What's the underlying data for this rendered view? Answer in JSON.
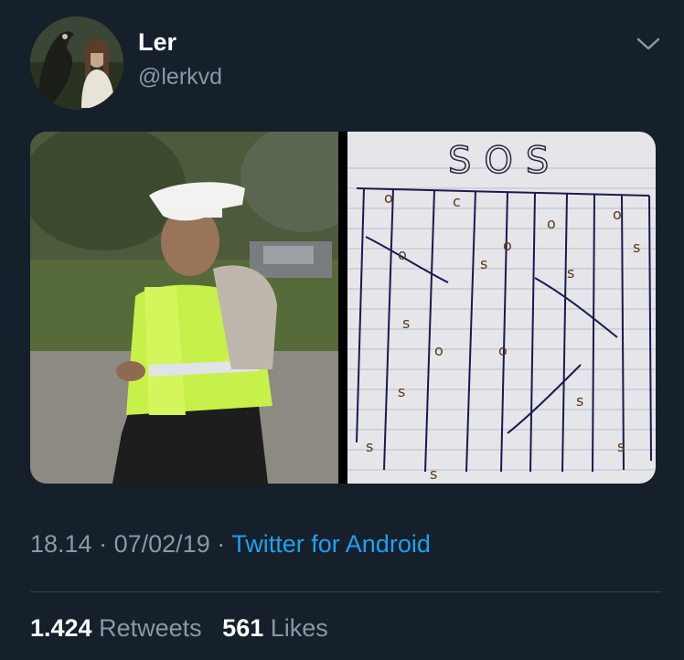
{
  "user": {
    "name": "Ler",
    "handle": "@lerkvd",
    "avatar_icon": "avatar-eagle-person"
  },
  "menu": {
    "icon": "chevron-down-icon"
  },
  "media": {
    "left_image": "police-officer-photo",
    "right_image": "sos-play-drawing",
    "drawing_title": "SOS"
  },
  "meta": {
    "time": "18.14",
    "separator": "·",
    "date": "07/02/19",
    "source": "Twitter for Android"
  },
  "stats": {
    "retweets_count": "1.424",
    "retweets_label": "Retweets",
    "likes_count": "561",
    "likes_label": "Likes"
  },
  "colors": {
    "background": "#15202b",
    "secondary_text": "#8899a6",
    "link": "#1da1f2",
    "divider": "#38444d"
  }
}
